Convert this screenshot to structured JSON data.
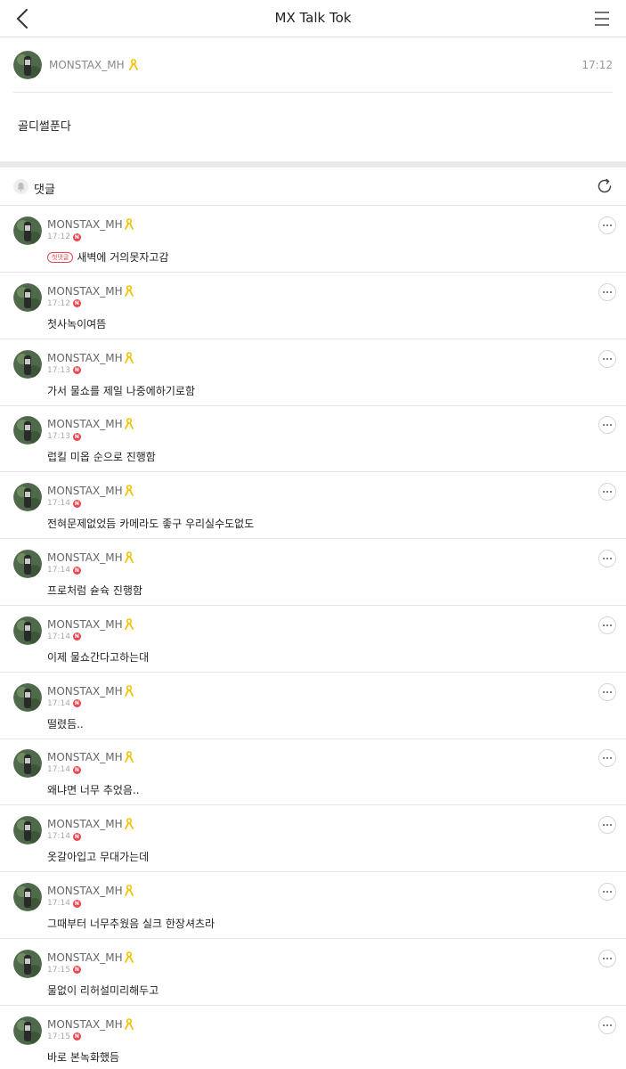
{
  "header": {
    "title": "MX Talk Tok"
  },
  "post": {
    "username": "MONSTAX_MH",
    "time": "17:12",
    "body": "골디썰푼다"
  },
  "comments_section": {
    "label": "댓글"
  },
  "colors": {
    "accent_red": "#e8474f",
    "ribbon_yellow": "#f2c200"
  },
  "icons": [
    "back-arrow-icon",
    "menu-icon",
    "yellow-ribbon-icon",
    "bell-icon",
    "refresh-icon",
    "more-icon",
    "new-badge-icon"
  ],
  "comments": [
    {
      "username": "MONSTAX_MH",
      "time": "17:12",
      "badge": "첫댓글",
      "text": "새벽에 거의못자고감"
    },
    {
      "username": "MONSTAX_MH",
      "time": "17:12",
      "text": "첫사녹이여뜸"
    },
    {
      "username": "MONSTAX_MH",
      "time": "17:13",
      "text": "가서 물쇼를 제일 나중에하기로함"
    },
    {
      "username": "MONSTAX_MH",
      "time": "17:13",
      "text": "럽킬 미옵 순으로 진행함"
    },
    {
      "username": "MONSTAX_MH",
      "time": "17:14",
      "text": "전혀문제없었듬 카메라도 좋구 우리실수도없도"
    },
    {
      "username": "MONSTAX_MH",
      "time": "17:14",
      "text": "프로처럼 슏슉 진행함"
    },
    {
      "username": "MONSTAX_MH",
      "time": "17:14",
      "text": "이제 물쇼간다고하는대"
    },
    {
      "username": "MONSTAX_MH",
      "time": "17:14",
      "text": "떨렸듬.."
    },
    {
      "username": "MONSTAX_MH",
      "time": "17:14",
      "text": "왜냐면 너무 추었음.."
    },
    {
      "username": "MONSTAX_MH",
      "time": "17:14",
      "text": "옷갈아입고 무대가는데"
    },
    {
      "username": "MONSTAX_MH",
      "time": "17:14",
      "text": "그때부터 너무추웠음 실크 한장셔츠라"
    },
    {
      "username": "MONSTAX_MH",
      "time": "17:15",
      "text": "물없이 리허설미리해두고"
    },
    {
      "username": "MONSTAX_MH",
      "time": "17:15",
      "text": "바로 본녹화했듬"
    }
  ]
}
